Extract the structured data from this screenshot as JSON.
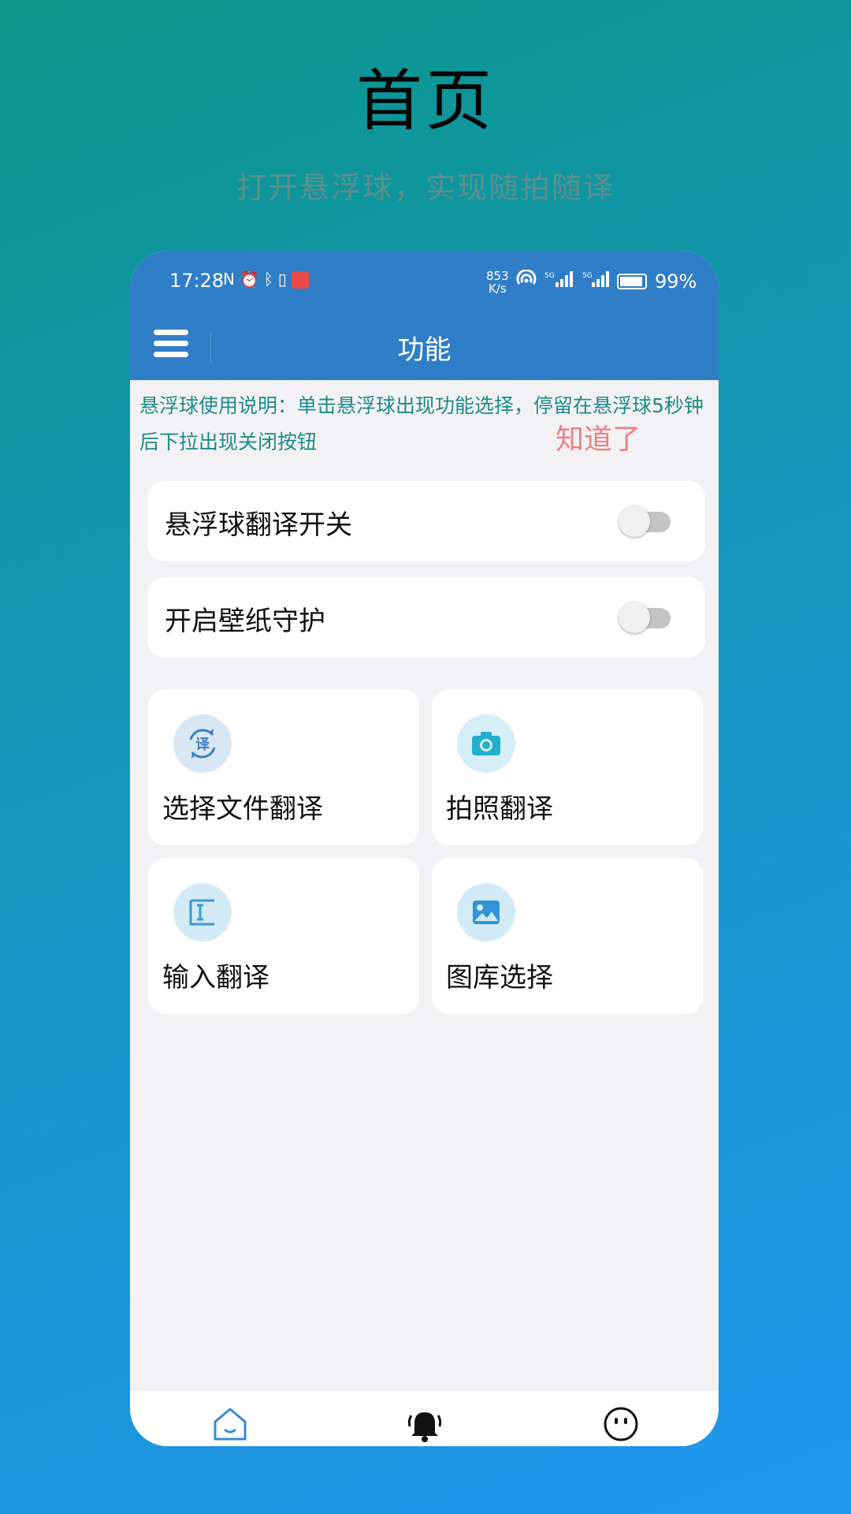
{
  "promo": {
    "title": "首页",
    "subtitle": "打开悬浮球，实现随拍随译"
  },
  "status_bar": {
    "time": "17:28",
    "speed_value": "853",
    "speed_unit": "K/s",
    "battery": "99%"
  },
  "app_bar": {
    "title": "功能",
    "menu_icon": "hamburger-menu-icon"
  },
  "notice": {
    "text": "悬浮球使用说明：单击悬浮球出现功能选择，停留在悬浮球5秒钟后下拉出现关闭按钮",
    "ack_label": "知道了"
  },
  "toggles": [
    {
      "label": "悬浮球翻译开关",
      "on": false
    },
    {
      "label": "开启壁纸守护",
      "on": false
    }
  ],
  "tiles": [
    {
      "label": "选择文件翻译",
      "icon": "translate-cycle-icon"
    },
    {
      "label": "拍照翻译",
      "icon": "camera-icon"
    },
    {
      "label": "输入翻译",
      "icon": "text-input-icon"
    },
    {
      "label": "图库选择",
      "icon": "image-gallery-icon"
    }
  ],
  "bottom_nav": [
    {
      "icon": "home-icon",
      "active": true
    },
    {
      "icon": "bell-icon",
      "active": false
    },
    {
      "icon": "face-icon",
      "active": false
    }
  ],
  "colors": {
    "primary": "#2f7ec7",
    "notice_text": "#1e8a8a",
    "ack_text": "#ee7f7f",
    "background_top": "#0a9687",
    "background_bottom": "#2196ef"
  }
}
